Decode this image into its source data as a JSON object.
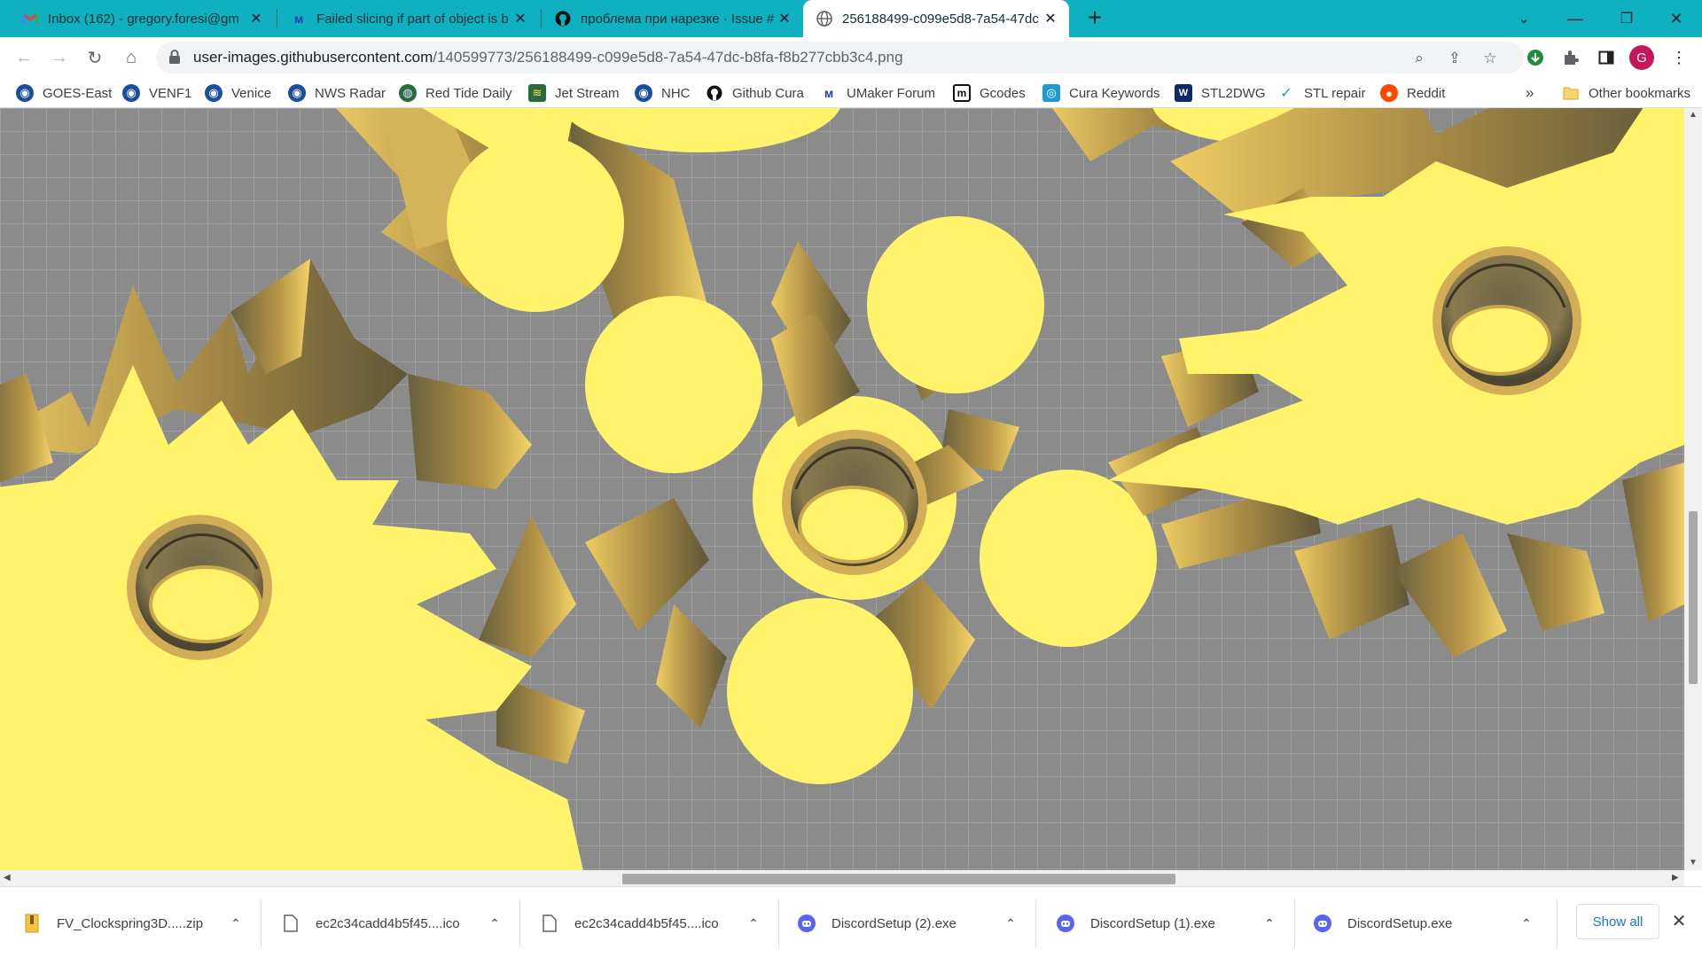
{
  "tabs": [
    {
      "title": "Inbox (162) - gregory.foresi@gm",
      "icon": "gmail-icon",
      "active": false
    },
    {
      "title": "Failed slicing if part of object is b",
      "icon": "ultimaker-icon",
      "active": false
    },
    {
      "title": "проблема при нарезке · Issue #",
      "icon": "github-icon",
      "active": false
    },
    {
      "title": "256188499-c099e5d8-7a54-47dc",
      "icon": "globe-icon",
      "active": true
    }
  ],
  "toolbar": {
    "url_host": "user-images.githubusercontent.com",
    "url_path": "/140599773/256188499-c099e5d8-7a54-47dc-b8fa-f8b277cbb3c4.png",
    "profile_initial": "G"
  },
  "bookmarks": [
    {
      "label": "GOES-East",
      "icon": "noaa-icon"
    },
    {
      "label": "VENF1",
      "icon": "noaa-icon"
    },
    {
      "label": "Venice",
      "icon": "noaa-icon"
    },
    {
      "label": "NWS Radar",
      "icon": "noaa-icon"
    },
    {
      "label": "Red Tide Daily",
      "icon": "globe-icon"
    },
    {
      "label": "Jet Stream",
      "icon": "jetstream-icon"
    },
    {
      "label": "NHC",
      "icon": "noaa-icon"
    },
    {
      "label": "Github Cura",
      "icon": "github-icon"
    },
    {
      "label": "UMaker Forum",
      "icon": "ultimaker-icon"
    },
    {
      "label": "Gcodes",
      "icon": "marlin-icon"
    },
    {
      "label": "Cura Keywords",
      "icon": "cura-icon"
    },
    {
      "label": "STL2DWG",
      "icon": "stl2dwg-icon"
    },
    {
      "label": "STL repair",
      "icon": "stl-repair-icon"
    },
    {
      "label": "Reddit",
      "icon": "reddit-icon"
    }
  ],
  "other_bookmarks": "Other bookmarks",
  "bookmarks_overflow": "»",
  "downloads": [
    {
      "name": "FV_Clockspring3D.....zip",
      "icon": "zip-icon"
    },
    {
      "name": "ec2c34cadd4b5f45....ico",
      "icon": "file-icon"
    },
    {
      "name": "ec2c34cadd4b5f45....ico",
      "icon": "file-icon"
    },
    {
      "name": "DiscordSetup (2).exe",
      "icon": "discord-icon"
    },
    {
      "name": "DiscordSetup (1).exe",
      "icon": "discord-icon"
    },
    {
      "name": "DiscordSetup.exe",
      "icon": "discord-icon"
    }
  ],
  "downloads_show_all": "Show all",
  "colors": {
    "tabstrip": "#0fb0bf",
    "part_yellow": "#fff36b",
    "part_shade": "#c9a84e",
    "build_plate": "#8b8b8b",
    "grid_line": "#9d9d9d"
  }
}
